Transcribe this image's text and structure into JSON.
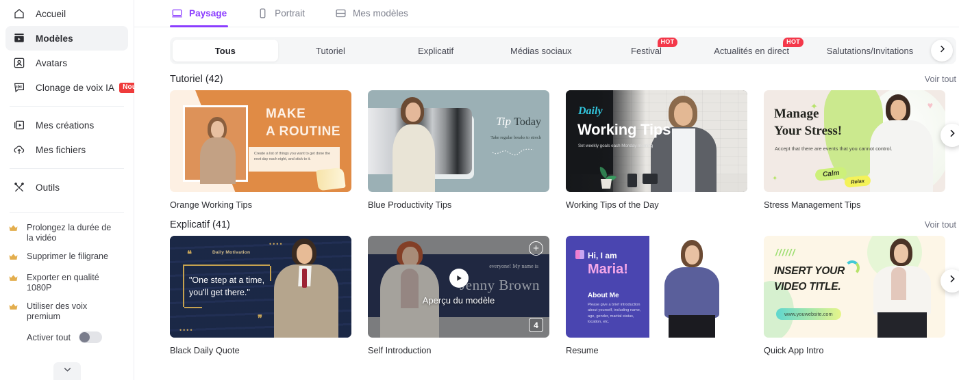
{
  "sidebar": {
    "nav": [
      {
        "label": "Accueil",
        "icon": "home-icon",
        "active": false
      },
      {
        "label": "Modèles",
        "icon": "templates-icon",
        "active": true
      },
      {
        "label": "Avatars",
        "icon": "avatar-icon",
        "active": false
      },
      {
        "label": "Clonage de voix IA",
        "icon": "voice-icon",
        "active": false,
        "badge": "Nouveau"
      }
    ],
    "nav2": [
      {
        "label": "Mes créations",
        "icon": "creations-icon"
      },
      {
        "label": "Mes fichiers",
        "icon": "files-icon"
      }
    ],
    "nav3": [
      {
        "label": "Outils",
        "icon": "tools-icon"
      }
    ],
    "premium": [
      "Prolongez la durée de la vidéo",
      "Supprimer le filigrane",
      "Exporter en qualité 1080P",
      "Utiliser des voix premium"
    ],
    "activer_label": "Activer tout",
    "activer_on": false
  },
  "tabs": [
    {
      "label": "Paysage",
      "icon": "landscape-icon",
      "active": true
    },
    {
      "label": "Portrait",
      "icon": "portrait-icon",
      "active": false
    },
    {
      "label": "Mes modèles",
      "icon": "my-templates-icon",
      "active": false
    }
  ],
  "filters": [
    {
      "label": "Tous",
      "active": true
    },
    {
      "label": "Tutoriel",
      "active": false
    },
    {
      "label": "Explicatif",
      "active": false
    },
    {
      "label": "Médias sociaux",
      "active": false
    },
    {
      "label": "Festival",
      "active": false,
      "hot": "HOT"
    },
    {
      "label": "Actualités en direct",
      "active": false,
      "hot": "HOT"
    },
    {
      "label": "Salutations/Invitations",
      "active": false
    }
  ],
  "see_all_label": "Voir tout",
  "sections": [
    {
      "title": "Tutoriel (42)",
      "cards": [
        {
          "title": "Orange Working Tips",
          "art": "c1",
          "text": {
            "headline1": "MAKE",
            "headline2": "A ROUTINE",
            "body": "Create a list of things you want to get done the next day each night, and stick to it."
          }
        },
        {
          "title": "Blue Productivity Tips",
          "art": "c2",
          "text": {
            "tip": "Tip",
            "today": "Today",
            "sub": "Take regular breaks to strech"
          }
        },
        {
          "title": "Working Tips of the Day",
          "art": "c3",
          "text": {
            "daily": "Daily",
            "headline": "Working Tips",
            "body": "Set weekly goals each Monday morning"
          }
        },
        {
          "title": "Stress Management Tips",
          "art": "c4",
          "text": {
            "headline1": "Manage",
            "headline2": "Your Stress!",
            "body": "Accept that there are events that you cannot control.",
            "tag1": "Calm",
            "tag2": "Relax"
          }
        }
      ]
    },
    {
      "title": "Explicatif (41)",
      "cards": [
        {
          "title": "Black Daily Quote",
          "art": "c5",
          "text": {
            "label": "Daily Motivation",
            "quote": "\"One step at a time, you'll get there.\""
          }
        },
        {
          "title": "Self Introduction",
          "art": "c6",
          "hover": true,
          "overlay": {
            "preview_label": "Aperçu du modèle",
            "count": "4",
            "add_icon": "plus-icon",
            "play_icon": "play-icon"
          },
          "text": {
            "line1": "everyone! My name is",
            "name": "Jenny Brown"
          }
        },
        {
          "title": "Resume",
          "art": "c7",
          "text": {
            "hi": "Hi, I am",
            "name": "Maria!",
            "about": "About Me",
            "body": "Please give a brief introduction about yourself, including name, age, gender, marital status, location, etc."
          }
        },
        {
          "title": "Quick App Intro",
          "art": "c8",
          "text": {
            "headline": "INSERT YOUR VIDEO TITLE.",
            "url": "www.youwebsite.com"
          }
        }
      ]
    }
  ],
  "colors": {
    "accent": "#8b3dff",
    "hot": "#f4384a",
    "new": "#ef3b3b",
    "crown": "#e3ae4e"
  }
}
